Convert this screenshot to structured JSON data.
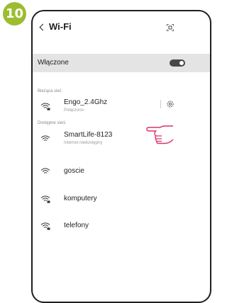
{
  "step_number": "10",
  "header": {
    "title": "Wi-Fi",
    "back_icon": "chevron-left-icon",
    "qr_icon": "qr-scan-icon"
  },
  "toggle": {
    "label": "Włączone",
    "state": "on"
  },
  "current_network": {
    "section_label": "Bieżąca sieć",
    "name": "Engo_2.4Ghz",
    "status": "Połączono",
    "icon": "wifi-lock-icon"
  },
  "available": {
    "section_label": "Dostępne sieci",
    "networks": [
      {
        "name": "SmartLife-8123",
        "status": "Internet niedostępny",
        "icon": "wifi-icon"
      },
      {
        "name": "goscie",
        "icon": "wifi-icon"
      },
      {
        "name": "komputery",
        "icon": "wifi-lock-icon"
      },
      {
        "name": "telefony",
        "icon": "wifi-lock-icon"
      }
    ]
  },
  "colors": {
    "badge": "#9bbd2f",
    "pointer": "#d6336c",
    "toggle_row": "#e4e4e4"
  }
}
